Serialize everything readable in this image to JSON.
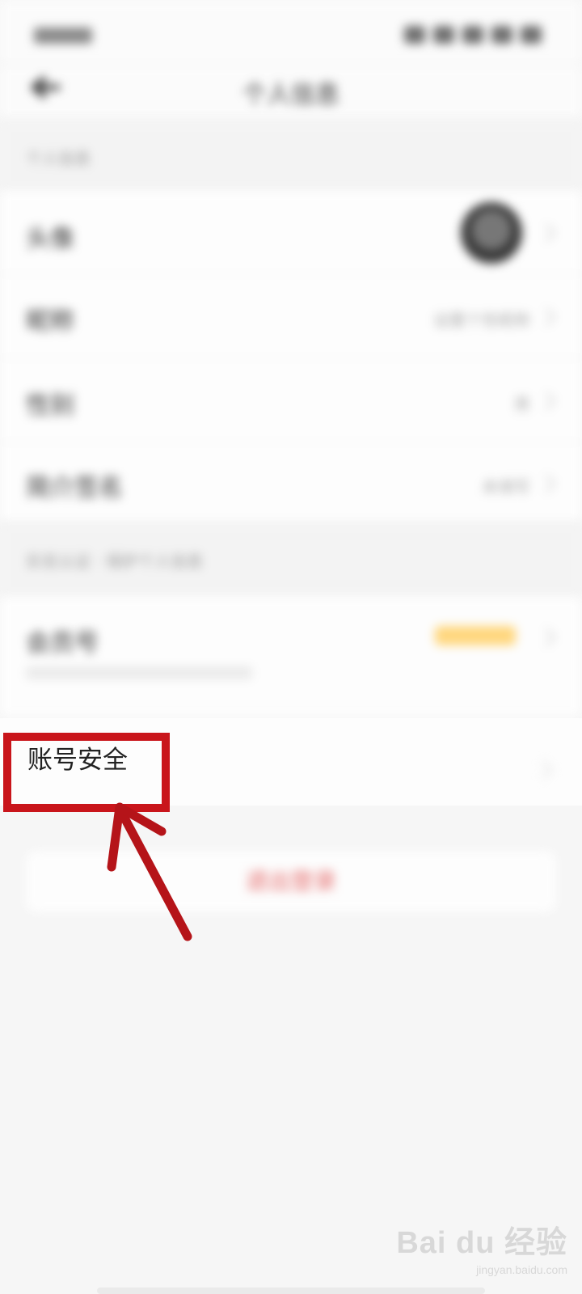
{
  "page": {
    "title": "个人信息",
    "account_security_label": "账号安全"
  },
  "section_one": {
    "header": "个人信息",
    "rows": [
      {
        "label": "头像",
        "value": ""
      },
      {
        "label": "昵称",
        "value": "设置个性昵称"
      },
      {
        "label": "性别",
        "value": "男"
      },
      {
        "label": "简介签名",
        "value": "未填写"
      }
    ]
  },
  "section_two": {
    "header": "实名认证 · 保护个人信息",
    "row": {
      "label": "会员号",
      "badge": "",
      "subtitle": ""
    }
  },
  "logout": {
    "label": "退出登录"
  },
  "watermark": {
    "main": "Bai du 经验",
    "sub": "jingyan.baidu.com"
  },
  "colors": {
    "highlight": "#c9151b",
    "logout": "#e46a6a",
    "badge": "#ffd77e"
  }
}
